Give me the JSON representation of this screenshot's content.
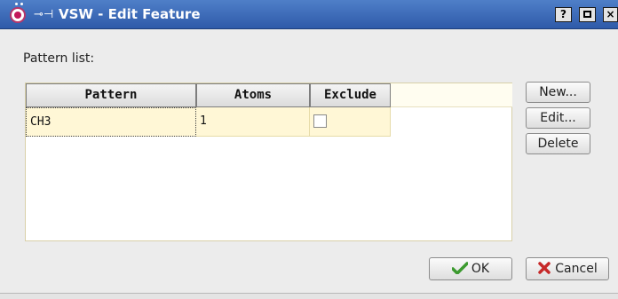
{
  "window": {
    "title": "VSW - Edit Feature",
    "titlebar_buttons": {
      "help": "?",
      "maximize": "",
      "close": "×"
    }
  },
  "main": {
    "pattern_list_label": "Pattern list:",
    "table": {
      "columns": [
        "Pattern",
        "Atoms",
        "Exclude"
      ],
      "rows": [
        {
          "pattern": "CH3",
          "atoms": "1",
          "exclude": false
        }
      ]
    }
  },
  "side_buttons": {
    "new": "New...",
    "edit": "Edit...",
    "delete": "Delete"
  },
  "footer": {
    "ok": "OK",
    "cancel": "Cancel"
  },
  "colors": {
    "titlebar": "#3a69b8",
    "row_highlight": "#fff7d6",
    "ok_icon": "#3c9a2f",
    "cancel_icon": "#c62828"
  }
}
